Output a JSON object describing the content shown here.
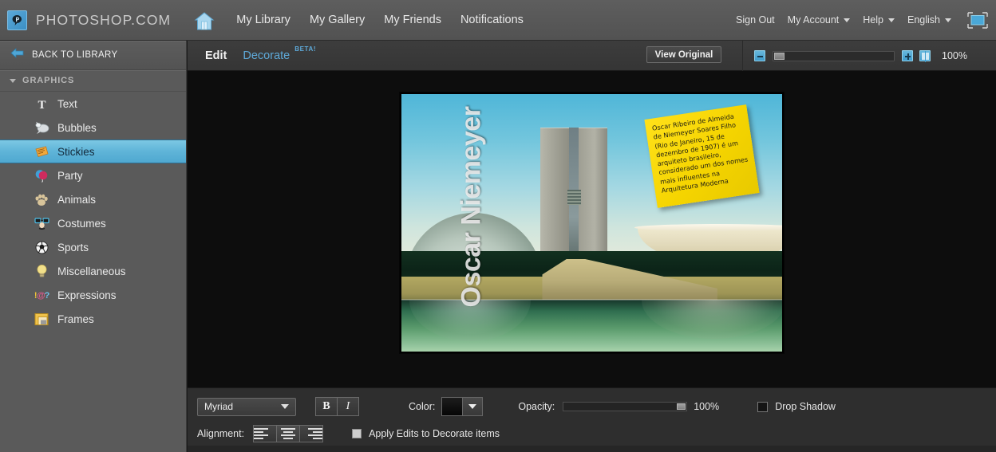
{
  "header": {
    "brand": "PHOTOSHOP.COM",
    "logo_icon": "photoshop-p-logo-icon",
    "home_icon": "home-icon",
    "nav": [
      {
        "label": "My Library"
      },
      {
        "label": "My Gallery"
      },
      {
        "label": "My Friends"
      },
      {
        "label": "Notifications"
      }
    ],
    "right": {
      "sign_out": "Sign Out",
      "my_account": "My Account",
      "help": "Help",
      "language": "English",
      "fullscreen_icon": "fullscreen-monitor-icon"
    }
  },
  "sidebar": {
    "back_to_library": "BACK TO LIBRARY",
    "back_icon": "back-arrow-icon",
    "section_title": "GRAPHICS",
    "section_caret": "chevron-down-icon",
    "items": [
      {
        "label": "Text",
        "icon": "text-t-icon",
        "selected": false
      },
      {
        "label": "Bubbles",
        "icon": "speech-bubble-icon",
        "selected": false
      },
      {
        "label": "Stickies",
        "icon": "sticky-note-icon",
        "selected": true
      },
      {
        "label": "Party",
        "icon": "balloons-icon",
        "selected": false
      },
      {
        "label": "Animals",
        "icon": "paw-print-icon",
        "selected": false
      },
      {
        "label": "Costumes",
        "icon": "glasses-nose-icon",
        "selected": false
      },
      {
        "label": "Sports",
        "icon": "soccer-ball-icon",
        "selected": false
      },
      {
        "label": "Miscellaneous",
        "icon": "lightbulb-icon",
        "selected": false
      },
      {
        "label": "Expressions",
        "icon": "punctuation-icon",
        "selected": false
      },
      {
        "label": "Frames",
        "icon": "picture-frame-icon",
        "selected": false
      }
    ]
  },
  "toolbar": {
    "tab_edit": "Edit",
    "tab_decorate": "Decorate",
    "beta_badge": "BETA!",
    "view_original": "View Original",
    "zoom_out_icon": "zoom-out-icon",
    "zoom_in_icon": "zoom-in-icon",
    "zoom_fit_icon": "zoom-fit-icon",
    "zoom_level": "100%"
  },
  "canvas": {
    "photo_title": "Oscar Niemeyer",
    "sticky_note_text": "Oscar Ribeiro de Almeida de Niemeyer Soares Filho (Rio de Janeiro, 15 de dezembro de 1907) é um arquiteto brasileiro, considerado um dos nomes mais influentes na Arquitetura Moderna"
  },
  "bottombar": {
    "font_family": "Myriad",
    "bold": "B",
    "italic": "I",
    "color_label": "Color:",
    "color_value": "#0a0a0a",
    "opacity_label": "Opacity:",
    "opacity_value": "100%",
    "drop_shadow_label": "Drop Shadow",
    "alignment_label": "Alignment:",
    "align_left_icon": "align-left-icon",
    "align_center_icon": "align-center-icon",
    "align_right_icon": "align-right-icon",
    "apply_edits_label": "Apply Edits to Decorate items"
  },
  "colors": {
    "accent_blue": "#5ea9d8",
    "sidebar_bg": "#5a5a5a",
    "header_bg": "#585858",
    "toolbar_bg": "#393939",
    "bottombar_bg": "#2e2e2e",
    "canvas_bg": "#0d0d0d",
    "sticky_yellow": "#f5d400",
    "selected_row": "#5fb4d8"
  }
}
